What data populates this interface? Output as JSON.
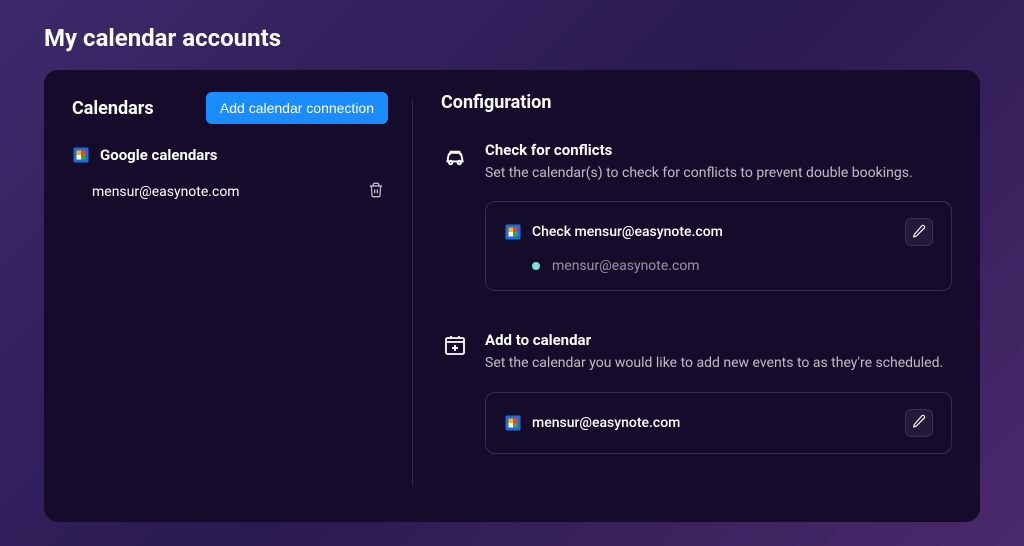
{
  "page": {
    "title": "My calendar accounts"
  },
  "left": {
    "title": "Calendars",
    "add_button": "Add calendar connection",
    "provider_label": "Google calendars",
    "account_email": "mensur@easynote.com"
  },
  "config": {
    "title": "Configuration",
    "conflicts": {
      "title": "Check for conflicts",
      "desc": "Set the calendar(s) to check for conflicts to prevent double bookings.",
      "check_label": "Check mensur@easynote.com",
      "sub_email": "mensur@easynote.com"
    },
    "addto": {
      "title": "Add to calendar",
      "desc": "Set the calendar you would like to add new events to as they're scheduled.",
      "selected_email": "mensur@easynote.com"
    }
  }
}
